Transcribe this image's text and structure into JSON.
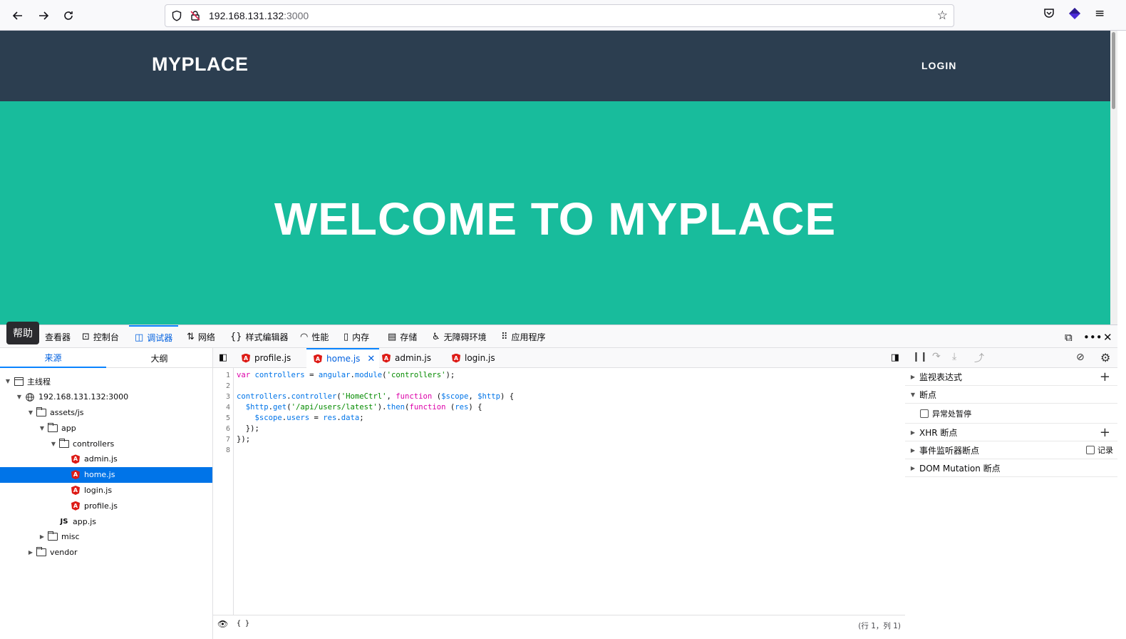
{
  "browser": {
    "url_host": "192.168.131.132",
    "url_port": ":3000",
    "back_icon": "arrow-left-icon",
    "forward_icon": "arrow-right-icon",
    "reload_icon": "reload-icon"
  },
  "site": {
    "brand": "MYPLACE",
    "login": "LOGIN",
    "hero_title": "WELCOME TO MYPLACE"
  },
  "devtools": {
    "tooltip": "帮助",
    "tabs": [
      "查看器",
      "控制台",
      "调试器",
      "网络",
      "样式编辑器",
      "性能",
      "内存",
      "存储",
      "无障碍环境",
      "应用程序"
    ],
    "active_tab": "调试器"
  },
  "sources": {
    "tab_sources": "来源",
    "tab_outline": "大纲",
    "tree": [
      {
        "label": "主线程",
        "depth": 0,
        "kind": "thread",
        "open": true
      },
      {
        "label": "192.168.131.132:3000",
        "depth": 1,
        "kind": "globe",
        "open": true
      },
      {
        "label": "assets/js",
        "depth": 2,
        "kind": "folder",
        "open": true
      },
      {
        "label": "app",
        "depth": 3,
        "kind": "folder",
        "open": true
      },
      {
        "label": "controllers",
        "depth": 4,
        "kind": "folder",
        "open": true
      },
      {
        "label": "admin.js",
        "depth": 5,
        "kind": "angular"
      },
      {
        "label": "home.js",
        "depth": 5,
        "kind": "angular",
        "selected": true
      },
      {
        "label": "login.js",
        "depth": 5,
        "kind": "angular"
      },
      {
        "label": "profile.js",
        "depth": 5,
        "kind": "angular"
      },
      {
        "label": "app.js",
        "depth": 4,
        "kind": "js"
      },
      {
        "label": "misc",
        "depth": 3,
        "kind": "folder",
        "open": false
      },
      {
        "label": "vendor",
        "depth": 2,
        "kind": "folder",
        "open": false
      }
    ]
  },
  "editor": {
    "tabs": [
      {
        "label": "profile.js",
        "active": false
      },
      {
        "label": "home.js",
        "active": true
      },
      {
        "label": "admin.js",
        "active": false
      },
      {
        "label": "login.js",
        "active": false
      }
    ],
    "line_numbers": [
      "1",
      "2",
      "3",
      "4",
      "5",
      "6",
      "7",
      "8"
    ],
    "code": [
      "var controllers = angular.module('controllers');",
      "",
      "controllers.controller('HomeCtrl', function ($scope, $http) {",
      "  $http.get('/api/users/latest').then(function (res) {",
      "    $scope.users = res.data;",
      "  });",
      "});",
      ""
    ],
    "footer_braces": "{ }",
    "cursor_pos": "(行 1，列 1)"
  },
  "right_pane": {
    "watch": "监视表达式",
    "breakpoints": "断点",
    "pause_on_exceptions": "异常处暂停",
    "xhr_breakpoints": "XHR 断点",
    "event_listener_breakpoints": "事件监听器断点",
    "log": "记录",
    "dom_mutation": "DOM Mutation 断点"
  }
}
